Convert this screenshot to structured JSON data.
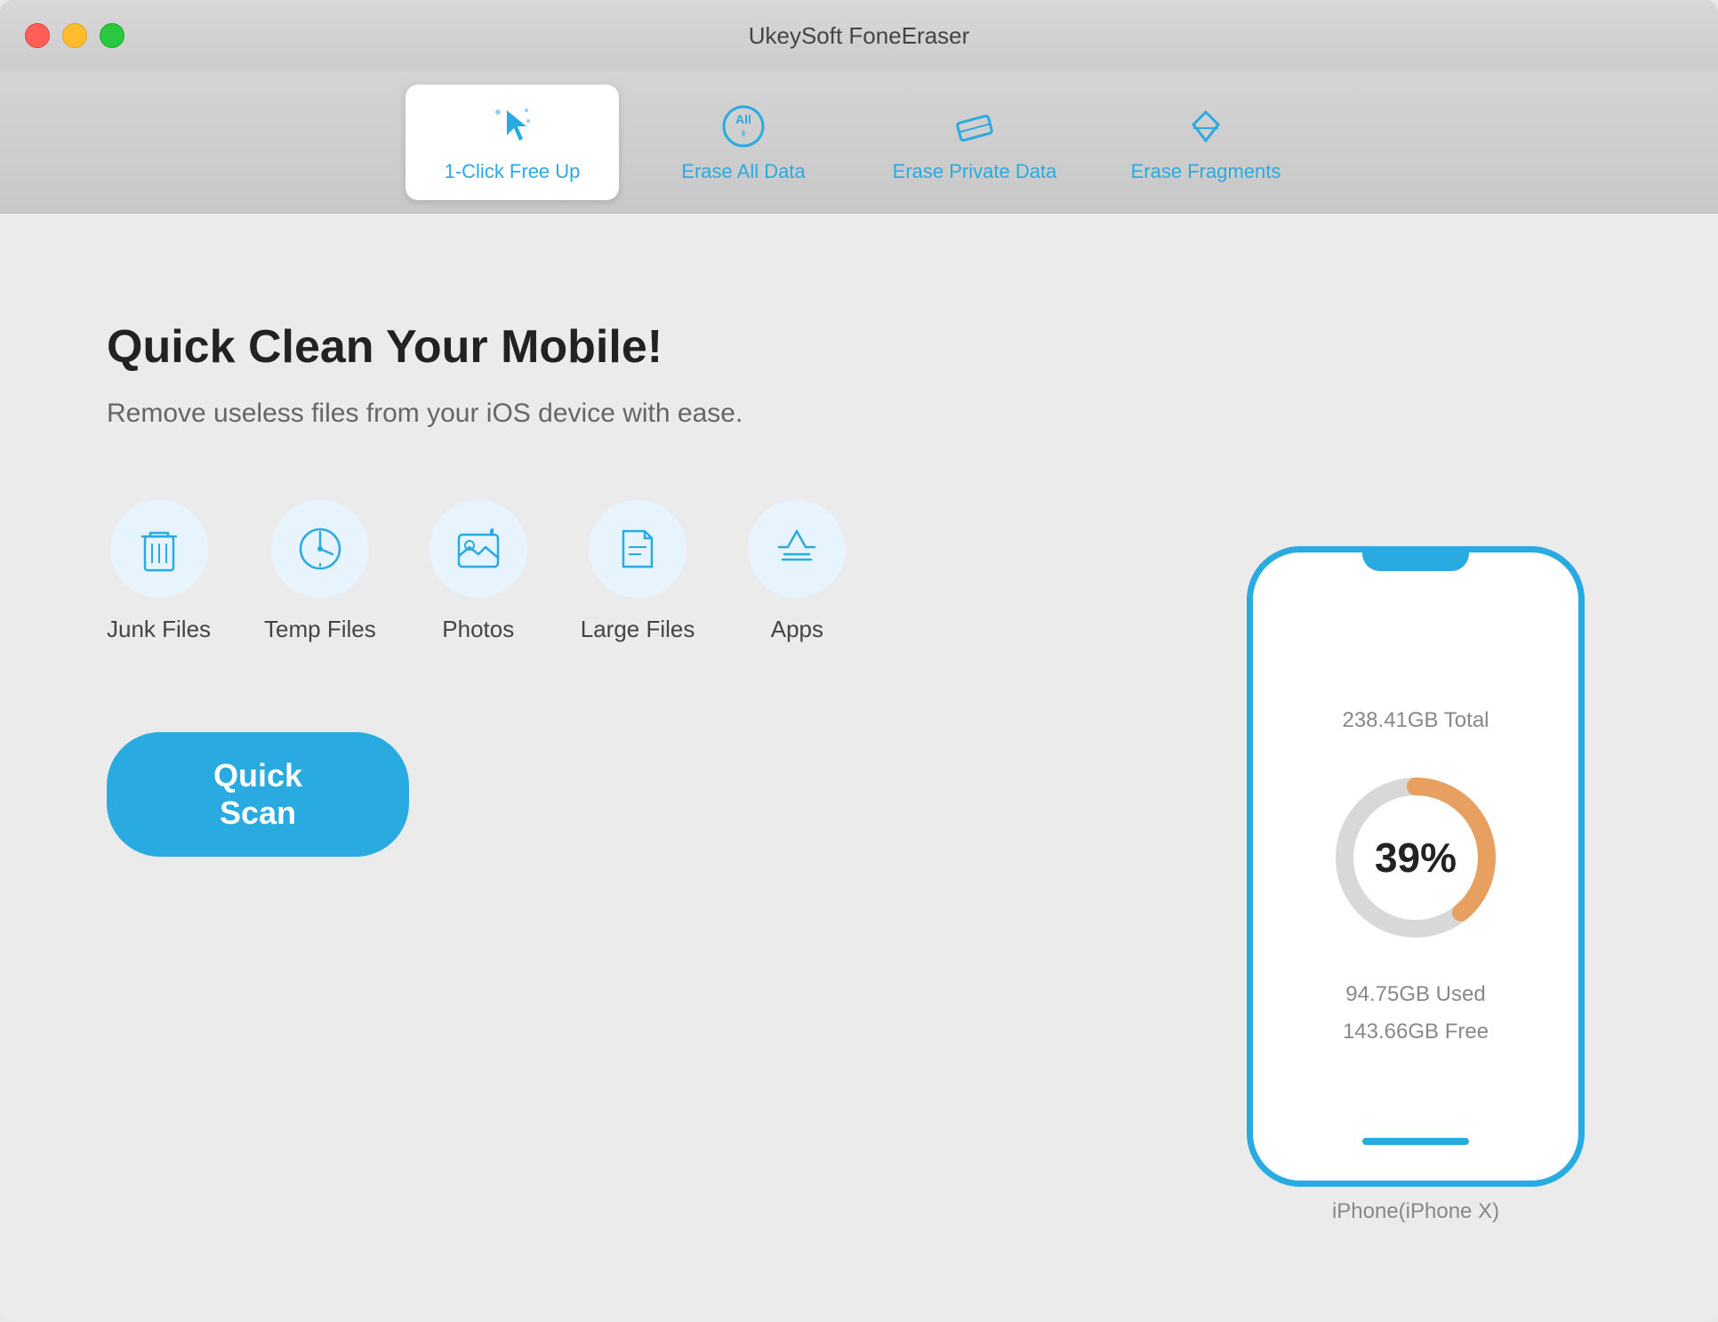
{
  "window": {
    "title": "UkeySoft FoneEraser"
  },
  "tabs": [
    {
      "id": "one-click",
      "label": "1-Click Free Up",
      "active": true
    },
    {
      "id": "erase-all",
      "label": "Erase All Data",
      "active": false
    },
    {
      "id": "erase-private",
      "label": "Erase Private Data",
      "active": false
    },
    {
      "id": "erase-fragments",
      "label": "Erase Fragments",
      "active": false
    }
  ],
  "main": {
    "headline": "Quick Clean Your Mobile!",
    "subtext": "Remove useless files from your iOS device with ease.",
    "file_types": [
      {
        "id": "junk-files",
        "label": "Junk Files"
      },
      {
        "id": "temp-files",
        "label": "Temp Files"
      },
      {
        "id": "photos",
        "label": "Photos"
      },
      {
        "id": "large-files",
        "label": "Large Files"
      },
      {
        "id": "apps",
        "label": "Apps"
      }
    ],
    "quick_scan_label": "Quick Scan"
  },
  "device": {
    "name": "iPhone(iPhone X)",
    "total": "238.41GB Total",
    "used": "94.75GB Used",
    "free": "143.66GB Free",
    "percent": 39,
    "percent_label": "39%"
  }
}
